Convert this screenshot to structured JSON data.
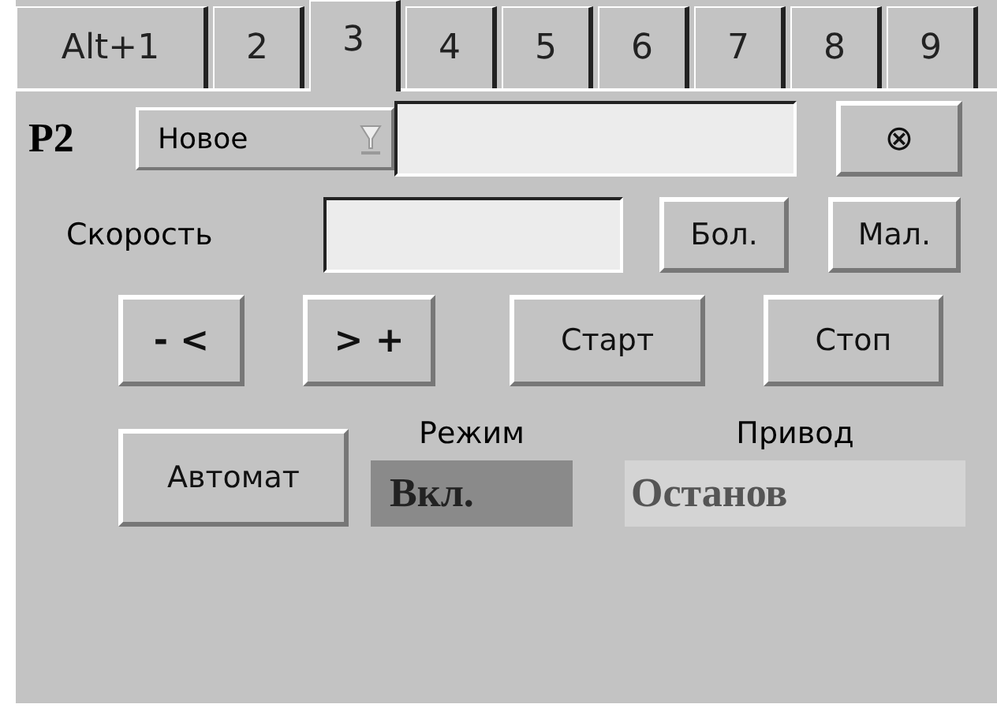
{
  "tabs": [
    {
      "label": "Alt+1",
      "selected": false
    },
    {
      "label": "2",
      "selected": false
    },
    {
      "label": "3",
      "selected": true
    },
    {
      "label": "4",
      "selected": false
    },
    {
      "label": "5",
      "selected": false
    },
    {
      "label": "6",
      "selected": false
    },
    {
      "label": "7",
      "selected": false
    },
    {
      "label": "8",
      "selected": false
    },
    {
      "label": "9",
      "selected": false
    }
  ],
  "device": {
    "name": "P2",
    "dropdown": "Новое",
    "close_symbol": "⊗"
  },
  "speed": {
    "label": "Скорость",
    "buttons": [
      "Бол.",
      "Мал."
    ]
  },
  "controls": [
    "- <",
    "> +",
    "Старт",
    "Стоп"
  ],
  "mode": {
    "button": "Автомат",
    "label": "Режим",
    "value": "Вкл."
  },
  "drive": {
    "label": "Привод",
    "value": "Останов"
  }
}
